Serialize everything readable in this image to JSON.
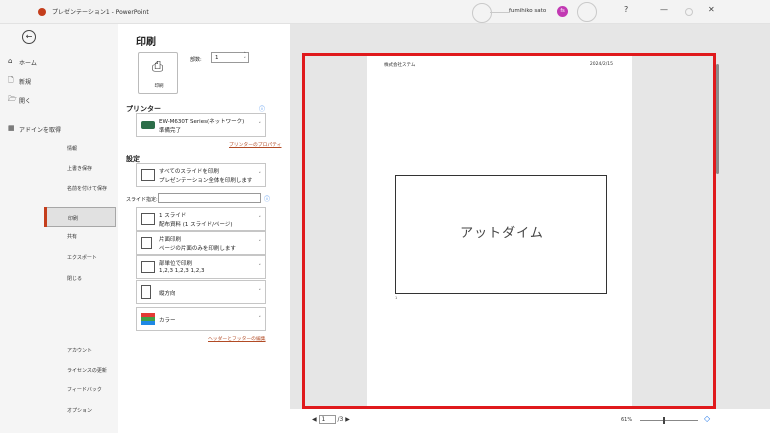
{
  "window": {
    "title": "プレゼンテーション1 - PowerPoint",
    "username": "fumihiko sato",
    "help": "?",
    "minimize": "—",
    "close": "✕"
  },
  "nav": {
    "back": "←",
    "items": [
      {
        "icon": "⌂",
        "label": "ホーム"
      },
      {
        "icon": "🗋",
        "label": "新規"
      },
      {
        "icon": "🗁",
        "label": "開く"
      },
      {
        "icon": "▦",
        "label": "アドインを取得"
      }
    ],
    "sub": [
      "情報",
      "上書き保存",
      "名前を付けて保存",
      "印刷",
      "共有",
      "エクスポート",
      "閉じる"
    ],
    "bottom": [
      "アカウント",
      "ライセンスの更新",
      "フィードバック",
      "オプション"
    ]
  },
  "print": {
    "title": "印刷",
    "button_label": "印刷",
    "copies_label": "部数:",
    "copies_value": "1",
    "printer_header": "プリンター",
    "printer_name": "EW-M630T Series(ネットワーク)",
    "printer_status": "準備完了",
    "printer_props_link": "プリンターのプロパティ",
    "settings_header": "設定",
    "slides_label": "スライド指定:",
    "settings": [
      {
        "l1": "すべてのスライドを印刷",
        "l2": "プレゼンテーション全体を印刷します"
      },
      {
        "l1": "1 スライド",
        "l2": "配布資料 (1 スライド/ページ)"
      },
      {
        "l1": "片面印刷",
        "l2": "ページの片面のみを印刷します"
      },
      {
        "l1": "部単位で印刷",
        "l2": "1,2,3    1,2,3    1,2,3"
      },
      {
        "l1": "縦方向",
        "l2": ""
      },
      {
        "l1": "カラー",
        "l2": ""
      }
    ],
    "header_footer_link": "ヘッダーとフッターの編集"
  },
  "preview": {
    "header_left": "株式会社ステム",
    "header_right": "2024/2/15",
    "slide_text": "アットダイム",
    "slide_number": "1",
    "page_current": "1",
    "page_total": "/3",
    "zoom": "61%"
  }
}
